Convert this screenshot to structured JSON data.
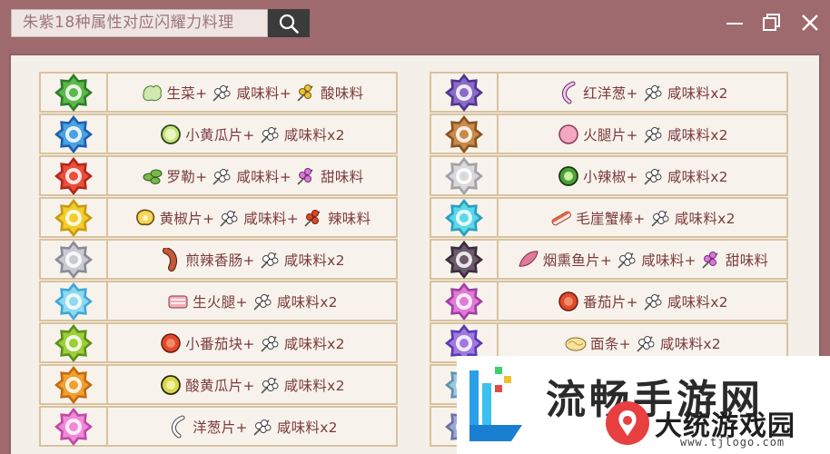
{
  "window": {
    "title": "朱紫18种属性对应闪耀力料理"
  },
  "colors": {
    "frame": "#9e6a6e",
    "content_bg": "#f4efe9",
    "cell_border": "#d9c29f",
    "text": "#7c3a3d"
  },
  "left_rows": [
    {
      "type_icon": "grass-type-icon",
      "type_color": "#5cb84a",
      "type_color2": "#2f7d2a",
      "parts": [
        {
          "icon": "lettuce-icon"
        },
        {
          "text": "生菜+"
        },
        {
          "icon": "herb-icon"
        },
        {
          "text": "咸味料+"
        },
        {
          "icon": "yellow-herb-icon"
        },
        {
          "text": "酸味料"
        }
      ]
    },
    {
      "type_icon": "water-type-icon",
      "type_color": "#4aa2e0",
      "type_color2": "#1f5fae",
      "parts": [
        {
          "icon": "cucumber-icon"
        },
        {
          "text": "小黄瓜片+"
        },
        {
          "icon": "herb-icon"
        },
        {
          "text": "咸味料x2"
        }
      ]
    },
    {
      "type_icon": "fire-type-icon",
      "type_color": "#e8503c",
      "type_color2": "#b5261e",
      "parts": [
        {
          "icon": "basil-icon"
        },
        {
          "text": "罗勒+"
        },
        {
          "icon": "herb-icon"
        },
        {
          "text": "咸味料+"
        },
        {
          "icon": "pink-herb-icon"
        },
        {
          "text": "甜味料"
        }
      ]
    },
    {
      "type_icon": "electric-type-icon",
      "type_color": "#f2cc2a",
      "type_color2": "#c99a10",
      "parts": [
        {
          "icon": "yellow-pepper-icon"
        },
        {
          "text": "黄椒片+"
        },
        {
          "icon": "herb-icon"
        },
        {
          "text": "咸味料+"
        },
        {
          "icon": "red-herb-icon"
        },
        {
          "text": "辣味料"
        }
      ]
    },
    {
      "type_icon": "normal-type-icon",
      "type_color": "#c9c9d1",
      "type_color2": "#8b8b96",
      "parts": [
        {
          "icon": "sausage-icon"
        },
        {
          "text": "煎辣香肠+"
        },
        {
          "icon": "herb-icon"
        },
        {
          "text": "咸味料x2"
        }
      ]
    },
    {
      "type_icon": "ice-type-icon",
      "type_color": "#8fd8f2",
      "type_color2": "#3fa8d6",
      "parts": [
        {
          "icon": "ham-icon"
        },
        {
          "text": "生火腿+"
        },
        {
          "icon": "herb-icon"
        },
        {
          "text": "咸味料x2"
        }
      ]
    },
    {
      "type_icon": "bug-type-icon",
      "type_color": "#9ccf3a",
      "type_color2": "#5f8f1c",
      "parts": [
        {
          "icon": "tomato-icon"
        },
        {
          "text": "小番茄块+"
        },
        {
          "icon": "herb-icon"
        },
        {
          "text": "咸味料x2"
        }
      ]
    },
    {
      "type_icon": "fighting-type-icon",
      "type_color": "#f0a030",
      "type_color2": "#c66a10",
      "parts": [
        {
          "icon": "pickle-icon"
        },
        {
          "text": "酸黄瓜片+"
        },
        {
          "icon": "herb-icon"
        },
        {
          "text": "咸味料x2"
        }
      ]
    },
    {
      "type_icon": "fairy-type-icon",
      "type_color": "#f08ad8",
      "type_color2": "#c04aa8",
      "parts": [
        {
          "icon": "onion-icon"
        },
        {
          "text": "洋葱片+"
        },
        {
          "icon": "herb-icon"
        },
        {
          "text": "咸味料x2"
        }
      ]
    }
  ],
  "right_rows": [
    {
      "type_icon": "ghost-type-icon",
      "type_color": "#8a6cc8",
      "type_color2": "#4d3590",
      "parts": [
        {
          "icon": "red-onion-icon"
        },
        {
          "text": "红洋葱+"
        },
        {
          "icon": "herb-icon"
        },
        {
          "text": "咸味料x2"
        }
      ]
    },
    {
      "type_icon": "ground-type-icon",
      "type_color": "#c98a4a",
      "type_color2": "#8a5424",
      "parts": [
        {
          "icon": "ham-slice-icon"
        },
        {
          "text": "火腿片+"
        },
        {
          "icon": "herb-icon"
        },
        {
          "text": "咸味料x2"
        }
      ]
    },
    {
      "type_icon": "flying-type-icon",
      "type_color": "#d8d8d8",
      "type_color2": "#a0a0a8",
      "parts": [
        {
          "icon": "jalapeno-icon"
        },
        {
          "text": "小辣椒+"
        },
        {
          "icon": "herb-icon"
        },
        {
          "text": "咸味料x2"
        }
      ]
    },
    {
      "type_icon": "psychic-type-icon",
      "type_color": "#5ad8e8",
      "type_color2": "#2a9ec0",
      "parts": [
        {
          "icon": "crab-stick-icon"
        },
        {
          "text": "毛崖蟹棒+"
        },
        {
          "icon": "herb-icon"
        },
        {
          "text": "咸味料x2"
        }
      ]
    },
    {
      "type_icon": "dark-type-icon",
      "type_color": "#6a5a6a",
      "type_color2": "#3a2c3a",
      "parts": [
        {
          "icon": "smoked-fish-icon"
        },
        {
          "text": "烟熏鱼片+"
        },
        {
          "icon": "herb-icon"
        },
        {
          "text": "咸味料+"
        },
        {
          "icon": "pink-herb-icon"
        },
        {
          "text": "甜味料"
        }
      ]
    },
    {
      "type_icon": "poison-type-icon",
      "type_color": "#e07ad8",
      "type_color2": "#a040a0",
      "parts": [
        {
          "icon": "tomato-icon"
        },
        {
          "text": "番茄片+"
        },
        {
          "icon": "herb-icon"
        },
        {
          "text": "咸味料x2"
        }
      ]
    },
    {
      "type_icon": "dragon-type-icon",
      "type_color": "#a07ae0",
      "type_color2": "#5a3ab0",
      "parts": [
        {
          "icon": "noodles-icon"
        },
        {
          "text": "面条+"
        },
        {
          "icon": "herb-icon"
        },
        {
          "text": "咸味料x2"
        }
      ]
    },
    {
      "type_icon": "steel-type-icon",
      "type_color": "#9ec8e0",
      "type_color2": "#6090b0",
      "parts": []
    },
    {
      "type_icon": "rock-type-icon",
      "type_color": "#a0a8d0",
      "type_color2": "#6870a8",
      "parts": []
    }
  ],
  "watermark": {
    "big": "流畅手游网",
    "name": "大统游戏园",
    "url": "www.tjlogo.com"
  }
}
